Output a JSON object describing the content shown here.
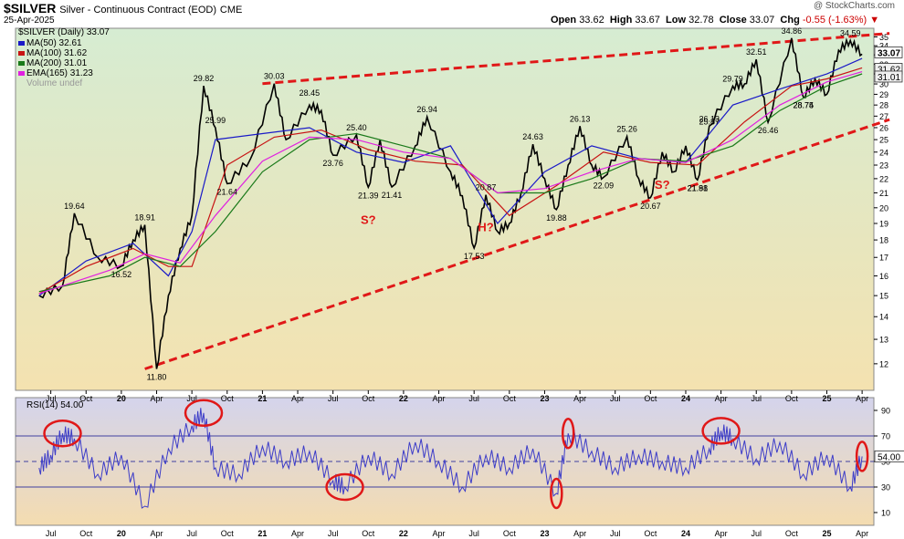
{
  "header": {
    "symbol": "$SILVER",
    "description": "Silver - Continuous Contract (EOD)",
    "exchange": "CME",
    "date": "25-Apr-2025",
    "watermark": "@ StockCharts.com",
    "open_label": "Open",
    "open": "33.62",
    "high_label": "High",
    "high": "33.67",
    "low_label": "Low",
    "low": "32.78",
    "close_label": "Close",
    "close": "33.07",
    "chg_label": "Chg",
    "chg": "-0.55 (-1.63%)"
  },
  "legend": {
    "price": "$SILVER (Daily) 33.07",
    "ma50": "MA(50) 32.61",
    "ma100": "MA(100) 31.62",
    "ma200": "MA(200) 31.01",
    "ema165": "EMA(165) 31.23",
    "volume": "Volume undef"
  },
  "rsi_legend": "RSI(14) 54.00",
  "colors": {
    "price": "#000000",
    "ma50": "#1a1ac8",
    "ma100": "#c81414",
    "ma200": "#1a7a1a",
    "ema165": "#e020e0",
    "rsi": "#3c3cc8",
    "trendline": "#e01818",
    "annotation": "#e01818",
    "price_bg_top": "#d6ecd2",
    "price_bg_bottom": "#f4e2b0",
    "rsi_bg_top": "#d4d4ec",
    "rsi_bg_bottom": "#f4dcb0"
  },
  "chart_data": [
    {
      "type": "line",
      "title": "$SILVER (Daily)",
      "xlabel": "",
      "ylabel": "",
      "x_ticks": [
        "Jul",
        "Oct",
        "20",
        "Apr",
        "Jul",
        "Oct",
        "21",
        "Apr",
        "Jul",
        "Oct",
        "22",
        "Apr",
        "Jul",
        "Oct",
        "23",
        "Apr",
        "Jul",
        "Oct",
        "24",
        "Apr",
        "Jul",
        "Oct",
        "25",
        "Apr"
      ],
      "y_ticks": [
        12,
        13,
        14,
        15,
        16,
        17,
        18,
        19,
        20,
        21,
        22,
        23,
        24,
        25,
        26,
        27,
        28,
        29,
        30,
        31,
        32,
        33,
        34,
        35
      ],
      "ylim": [
        11,
        36
      ],
      "log_scale": true,
      "grid": false,
      "legend_placement": "top-left",
      "series": [
        {
          "name": "$SILVER (Daily)",
          "x": [
            "2019-06",
            "2019-08",
            "2019-09",
            "2019-11",
            "2020-01",
            "2020-02",
            "2020-03",
            "2020-04",
            "2020-05",
            "2020-06",
            "2020-07",
            "2020-08",
            "2020-09",
            "2020-10",
            "2020-12",
            "2021-02",
            "2021-03",
            "2021-05",
            "2021-06",
            "2021-07",
            "2021-09",
            "2021-10",
            "2021-11",
            "2021-12",
            "2022-02",
            "2022-03",
            "2022-05",
            "2022-06",
            "2022-07",
            "2022-08",
            "2022-09",
            "2022-10",
            "2022-11",
            "2022-12",
            "2023-01",
            "2023-02",
            "2023-03",
            "2023-04",
            "2023-05",
            "2023-06",
            "2023-08",
            "2023-09",
            "2023-10",
            "2023-11",
            "2023-12",
            "2024-01",
            "2024-02",
            "2024-03",
            "2024-05",
            "2024-06",
            "2024-07",
            "2024-08",
            "2024-10",
            "2024-11",
            "2024-12",
            "2025-01",
            "2025-02",
            "2025-03",
            "2025-04"
          ],
          "values": [
            15.0,
            15.5,
            19.64,
            17.0,
            16.52,
            18.0,
            18.91,
            11.8,
            15.0,
            17.5,
            19.5,
            29.82,
            25.99,
            21.64,
            23.5,
            30.03,
            25.0,
            28.0,
            27.5,
            23.76,
            25.4,
            21.39,
            25.0,
            21.41,
            24.5,
            26.94,
            22.5,
            20.8,
            17.53,
            20.87,
            18.5,
            19.0,
            21.0,
            24.63,
            22.0,
            19.88,
            23.0,
            26.13,
            23.0,
            22.09,
            25.26,
            22.0,
            20.67,
            24.0,
            22.5,
            24.5,
            21.91,
            26.13,
            29.79,
            30.0,
            32.51,
            26.46,
            34.86,
            28.75,
            30.5,
            29.0,
            33.5,
            34.59,
            33.07
          ]
        },
        {
          "name": "MA(50)",
          "x": [
            "2019-06",
            "2019-10",
            "2020-02",
            "2020-05",
            "2020-07",
            "2020-09",
            "2021-01",
            "2021-05",
            "2021-09",
            "2022-01",
            "2022-05",
            "2022-09",
            "2023-01",
            "2023-05",
            "2023-09",
            "2024-01",
            "2024-05",
            "2024-09",
            "2025-01",
            "2025-04"
          ],
          "values": [
            15.0,
            16.8,
            17.8,
            16.0,
            18.5,
            25.0,
            25.5,
            26.0,
            24.0,
            23.2,
            24.5,
            19.0,
            22.5,
            24.5,
            23.5,
            23.2,
            28.0,
            29.5,
            31.0,
            32.61
          ]
        },
        {
          "name": "MA(100)",
          "x": [
            "2019-06",
            "2019-10",
            "2020-02",
            "2020-05",
            "2020-07",
            "2020-10",
            "2021-02",
            "2021-06",
            "2021-10",
            "2022-02",
            "2022-06",
            "2022-10",
            "2023-02",
            "2023-06",
            "2023-10",
            "2024-02",
            "2024-06",
            "2024-10",
            "2025-01",
            "2025-04"
          ],
          "values": [
            15.1,
            16.5,
            17.5,
            16.5,
            16.5,
            23.0,
            25.2,
            25.8,
            24.2,
            23.3,
            23.0,
            19.5,
            21.5,
            24.0,
            23.2,
            23.0,
            26.5,
            29.8,
            30.5,
            31.62
          ]
        },
        {
          "name": "MA(200)",
          "x": [
            "2019-06",
            "2019-12",
            "2020-03",
            "2020-06",
            "2020-09",
            "2021-01",
            "2021-05",
            "2021-09",
            "2022-01",
            "2022-05",
            "2022-09",
            "2023-01",
            "2023-05",
            "2023-09",
            "2024-01",
            "2024-05",
            "2024-09",
            "2025-01",
            "2025-04"
          ],
          "values": [
            15.2,
            16.0,
            17.0,
            16.5,
            18.5,
            22.5,
            25.0,
            25.5,
            24.5,
            23.5,
            21.0,
            21.0,
            22.0,
            23.5,
            23.3,
            24.5,
            27.5,
            29.8,
            31.01
          ]
        },
        {
          "name": "EMA(165)",
          "x": [
            "2019-06",
            "2019-12",
            "2020-03",
            "2020-06",
            "2020-09",
            "2021-01",
            "2021-05",
            "2021-09",
            "2022-01",
            "2022-05",
            "2022-09",
            "2023-01",
            "2023-05",
            "2023-09",
            "2024-01",
            "2024-05",
            "2024-09",
            "2025-01",
            "2025-04"
          ],
          "values": [
            15.1,
            16.3,
            17.2,
            16.7,
            19.5,
            23.3,
            25.2,
            25.0,
            24.0,
            23.5,
            21.0,
            21.3,
            22.5,
            23.5,
            23.2,
            25.0,
            28.0,
            30.2,
            31.23
          ]
        }
      ],
      "data_labels": [
        "19.64",
        "16.52",
        "18.91",
        "11.80",
        "29.82",
        "25.99",
        "21.64",
        "21.88",
        "30.03",
        "28.74",
        "23.76",
        "25.40",
        "21.39",
        "21.41",
        "26.94",
        "20.87",
        "17.53",
        "24.63",
        "19.88",
        "26.13",
        "25.26",
        "22.09",
        "20.67",
        "25.87",
        "21.91",
        "29.79",
        "26.13",
        "32.51",
        "26.46",
        "34.86",
        "28.75",
        "34.59",
        "28.45"
      ],
      "price_tags": [
        "33.07",
        "31.62",
        "31.01"
      ],
      "annotations": [
        "S?",
        "H?",
        "S?"
      ],
      "trendlines": [
        {
          "name": "upper resistance",
          "x": [
            "2021-01",
            "2025-04"
          ],
          "values": [
            30.03,
            35.3
          ]
        },
        {
          "name": "lower support",
          "x": [
            "2020-03",
            "2025-04"
          ],
          "values": [
            11.8,
            26.3
          ]
        }
      ]
    },
    {
      "type": "line",
      "title": "RSI(14)",
      "xlabel": "",
      "ylabel": "",
      "x_ticks": [
        "Jul",
        "Oct",
        "20",
        "Apr",
        "Jul",
        "Oct",
        "21",
        "Apr",
        "Jul",
        "Oct",
        "22",
        "Apr",
        "Jul",
        "Oct",
        "23",
        "Apr",
        "Jul",
        "Oct",
        "24",
        "Apr",
        "Jul",
        "Oct",
        "25",
        "Apr"
      ],
      "y_ticks": [
        10,
        30,
        50,
        70,
        90
      ],
      "reference_lines": [
        30,
        50,
        70
      ],
      "ylim": [
        0,
        100
      ],
      "grid": false,
      "series": [
        {
          "name": "RSI(14)",
          "x": [
            "2019-06",
            "2019-07",
            "2019-08",
            "2019-09",
            "2019-11",
            "2020-01",
            "2020-03",
            "2020-05",
            "2020-07",
            "2020-08",
            "2020-09",
            "2020-11",
            "2021-01",
            "2021-03",
            "2021-05",
            "2021-07",
            "2021-08",
            "2021-10",
            "2021-12",
            "2022-02",
            "2022-04",
            "2022-06",
            "2022-08",
            "2022-10",
            "2022-12",
            "2023-02",
            "2023-03",
            "2023-05",
            "2023-07",
            "2023-09",
            "2023-11",
            "2024-01",
            "2024-03",
            "2024-04",
            "2024-05",
            "2024-07",
            "2024-09",
            "2024-11",
            "2025-01",
            "2025-03",
            "2025-04"
          ],
          "values": [
            45,
            55,
            72,
            68,
            40,
            55,
            15,
            60,
            78,
            88,
            45,
            40,
            62,
            50,
            58,
            35,
            30,
            55,
            40,
            65,
            50,
            30,
            55,
            45,
            60,
            25,
            72,
            58,
            45,
            55,
            50,
            45,
            60,
            74,
            68,
            52,
            65,
            40,
            55,
            30,
            54
          ]
        }
      ],
      "highlighted_regions": [
        "2019-08",
        "2020-08",
        "2021-08",
        "2023-02",
        "2023-03",
        "2024-04",
        "2025-04"
      ]
    }
  ]
}
